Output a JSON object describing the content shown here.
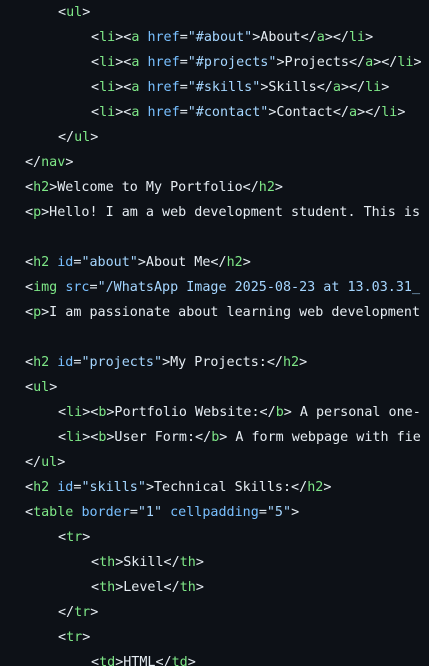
{
  "theme": {
    "background": "#0d1117",
    "tag": "#7ee787",
    "attribute": "#79c0ff",
    "string": "#a5d6ff",
    "text": "#e6edf3"
  },
  "lines": [
    {
      "indent": 1,
      "tokens": [
        [
          "p",
          "<"
        ],
        [
          "tag",
          "ul"
        ],
        [
          "p",
          ">"
        ]
      ]
    },
    {
      "indent": 2,
      "tokens": [
        [
          "p",
          "<"
        ],
        [
          "tag",
          "li"
        ],
        [
          "p",
          "><"
        ],
        [
          "tag",
          "a"
        ],
        [
          "p",
          " "
        ],
        [
          "attr",
          "href"
        ],
        [
          "p",
          "="
        ],
        [
          "str",
          "\"#about\""
        ],
        [
          "p",
          ">About</"
        ],
        [
          "tag",
          "a"
        ],
        [
          "p",
          "></"
        ],
        [
          "tag",
          "li"
        ],
        [
          "p",
          ">"
        ]
      ]
    },
    {
      "indent": 2,
      "tokens": [
        [
          "p",
          "<"
        ],
        [
          "tag",
          "li"
        ],
        [
          "p",
          "><"
        ],
        [
          "tag",
          "a"
        ],
        [
          "p",
          " "
        ],
        [
          "attr",
          "href"
        ],
        [
          "p",
          "="
        ],
        [
          "str",
          "\"#projects\""
        ],
        [
          "p",
          ">Projects</"
        ],
        [
          "tag",
          "a"
        ],
        [
          "p",
          "></"
        ],
        [
          "tag",
          "li"
        ],
        [
          "p",
          ">"
        ]
      ]
    },
    {
      "indent": 2,
      "tokens": [
        [
          "p",
          "<"
        ],
        [
          "tag",
          "li"
        ],
        [
          "p",
          "><"
        ],
        [
          "tag",
          "a"
        ],
        [
          "p",
          " "
        ],
        [
          "attr",
          "href"
        ],
        [
          "p",
          "="
        ],
        [
          "str",
          "\"#skills\""
        ],
        [
          "p",
          ">Skills</"
        ],
        [
          "tag",
          "a"
        ],
        [
          "p",
          "></"
        ],
        [
          "tag",
          "li"
        ],
        [
          "p",
          ">"
        ]
      ]
    },
    {
      "indent": 2,
      "tokens": [
        [
          "p",
          "<"
        ],
        [
          "tag",
          "li"
        ],
        [
          "p",
          "><"
        ],
        [
          "tag",
          "a"
        ],
        [
          "p",
          " "
        ],
        [
          "attr",
          "href"
        ],
        [
          "p",
          "="
        ],
        [
          "str",
          "\"#contact\""
        ],
        [
          "p",
          ">Contact</"
        ],
        [
          "tag",
          "a"
        ],
        [
          "p",
          "></"
        ],
        [
          "tag",
          "li"
        ],
        [
          "p",
          ">"
        ]
      ]
    },
    {
      "indent": 1,
      "tokens": [
        [
          "p",
          "</"
        ],
        [
          "tag",
          "ul"
        ],
        [
          "p",
          ">"
        ]
      ]
    },
    {
      "indent": 0,
      "tokens": [
        [
          "p",
          "</"
        ],
        [
          "tag",
          "nav"
        ],
        [
          "p",
          ">"
        ]
      ]
    },
    {
      "indent": 0,
      "tokens": [
        [
          "p",
          "<"
        ],
        [
          "tag",
          "h2"
        ],
        [
          "p",
          ">Welcome to My Portfolio</"
        ],
        [
          "tag",
          "h2"
        ],
        [
          "p",
          ">"
        ]
      ]
    },
    {
      "indent": 0,
      "tokens": [
        [
          "p",
          "<"
        ],
        [
          "tag",
          "p"
        ],
        [
          "p",
          ">Hello! I am a web development student. This is"
        ]
      ]
    },
    {
      "indent": 0,
      "tokens": []
    },
    {
      "indent": 0,
      "tokens": [
        [
          "p",
          "<"
        ],
        [
          "tag",
          "h2"
        ],
        [
          "p",
          " "
        ],
        [
          "attr",
          "id"
        ],
        [
          "p",
          "="
        ],
        [
          "str",
          "\"about\""
        ],
        [
          "p",
          ">About Me</"
        ],
        [
          "tag",
          "h2"
        ],
        [
          "p",
          ">"
        ]
      ]
    },
    {
      "indent": 0,
      "tokens": [
        [
          "p",
          "<"
        ],
        [
          "tag",
          "img"
        ],
        [
          "p",
          " "
        ],
        [
          "attr",
          "src"
        ],
        [
          "p",
          "="
        ],
        [
          "str",
          "\"/WhatsApp Image 2025-08-23 at 13.03.31_"
        ]
      ]
    },
    {
      "indent": 0,
      "tokens": [
        [
          "p",
          "<"
        ],
        [
          "tag",
          "p"
        ],
        [
          "p",
          ">I am passionate about learning web development"
        ]
      ]
    },
    {
      "indent": 0,
      "tokens": []
    },
    {
      "indent": 0,
      "tokens": [
        [
          "p",
          "<"
        ],
        [
          "tag",
          "h2"
        ],
        [
          "p",
          " "
        ],
        [
          "attr",
          "id"
        ],
        [
          "p",
          "="
        ],
        [
          "str",
          "\"projects\""
        ],
        [
          "p",
          ">My Projects:</"
        ],
        [
          "tag",
          "h2"
        ],
        [
          "p",
          ">"
        ]
      ]
    },
    {
      "indent": 0,
      "tokens": [
        [
          "p",
          "<"
        ],
        [
          "tag",
          "ul"
        ],
        [
          "p",
          ">"
        ]
      ]
    },
    {
      "indent": 1,
      "tokens": [
        [
          "p",
          "<"
        ],
        [
          "tag",
          "li"
        ],
        [
          "p",
          "><"
        ],
        [
          "tag",
          "b"
        ],
        [
          "p",
          ">Portfolio Website:</"
        ],
        [
          "tag",
          "b"
        ],
        [
          "p",
          "> A personal one-"
        ]
      ]
    },
    {
      "indent": 1,
      "tokens": [
        [
          "p",
          "<"
        ],
        [
          "tag",
          "li"
        ],
        [
          "p",
          "><"
        ],
        [
          "tag",
          "b"
        ],
        [
          "p",
          ">User Form:</"
        ],
        [
          "tag",
          "b"
        ],
        [
          "p",
          "> A form webpage with fie"
        ]
      ]
    },
    {
      "indent": 0,
      "tokens": [
        [
          "p",
          "</"
        ],
        [
          "tag",
          "ul"
        ],
        [
          "p",
          ">"
        ]
      ]
    },
    {
      "indent": 0,
      "tokens": [
        [
          "p",
          "<"
        ],
        [
          "tag",
          "h2"
        ],
        [
          "p",
          " "
        ],
        [
          "attr",
          "id"
        ],
        [
          "p",
          "="
        ],
        [
          "str",
          "\"skills\""
        ],
        [
          "p",
          ">Technical Skills:</"
        ],
        [
          "tag",
          "h2"
        ],
        [
          "p",
          ">"
        ]
      ]
    },
    {
      "indent": 0,
      "tokens": [
        [
          "p",
          "<"
        ],
        [
          "tag",
          "table"
        ],
        [
          "p",
          " "
        ],
        [
          "attr",
          "border"
        ],
        [
          "p",
          "="
        ],
        [
          "str",
          "\"1\""
        ],
        [
          "p",
          " "
        ],
        [
          "attr",
          "cellpadding"
        ],
        [
          "p",
          "="
        ],
        [
          "str",
          "\"5\""
        ],
        [
          "p",
          ">"
        ]
      ]
    },
    {
      "indent": 1,
      "tokens": [
        [
          "p",
          "<"
        ],
        [
          "tag",
          "tr"
        ],
        [
          "p",
          ">"
        ]
      ]
    },
    {
      "indent": 2,
      "tokens": [
        [
          "p",
          "<"
        ],
        [
          "tag",
          "th"
        ],
        [
          "p",
          ">Skill</"
        ],
        [
          "tag",
          "th"
        ],
        [
          "p",
          ">"
        ]
      ]
    },
    {
      "indent": 2,
      "tokens": [
        [
          "p",
          "<"
        ],
        [
          "tag",
          "th"
        ],
        [
          "p",
          ">Level</"
        ],
        [
          "tag",
          "th"
        ],
        [
          "p",
          ">"
        ]
      ]
    },
    {
      "indent": 1,
      "tokens": [
        [
          "p",
          "</"
        ],
        [
          "tag",
          "tr"
        ],
        [
          "p",
          ">"
        ]
      ]
    },
    {
      "indent": 1,
      "tokens": [
        [
          "p",
          "<"
        ],
        [
          "tag",
          "tr"
        ],
        [
          "p",
          ">"
        ]
      ]
    },
    {
      "indent": 2,
      "tokens": [
        [
          "p",
          "<"
        ],
        [
          "tag",
          "td"
        ],
        [
          "p",
          ">HTML</"
        ],
        [
          "tag",
          "td"
        ],
        [
          "p",
          ">"
        ]
      ]
    }
  ]
}
